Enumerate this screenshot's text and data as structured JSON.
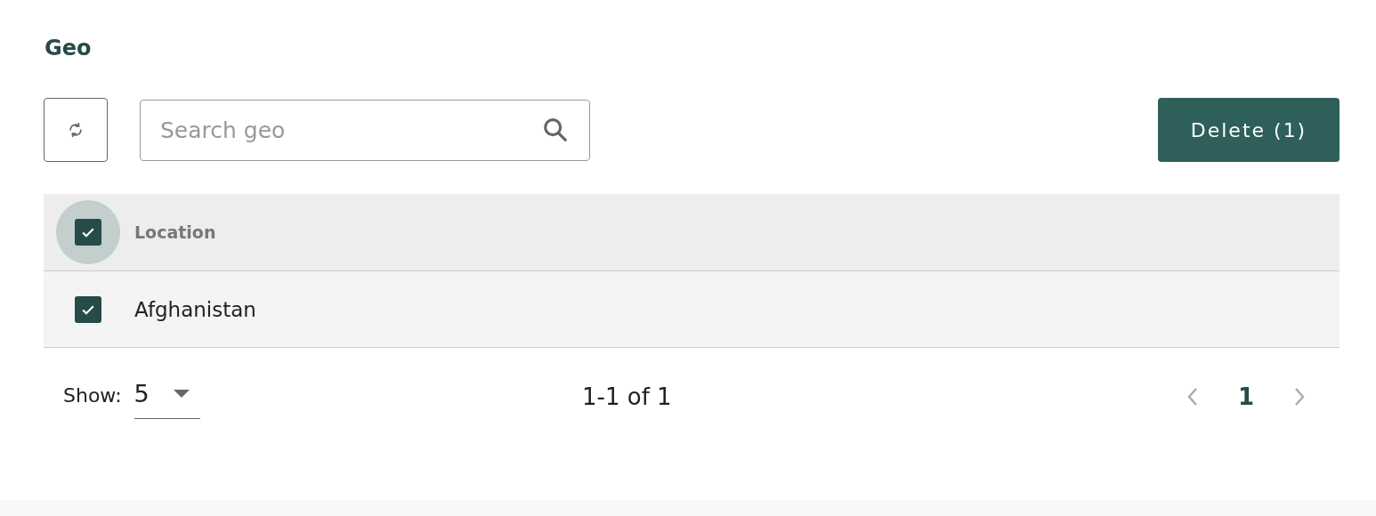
{
  "title": "Geo",
  "toolbar": {
    "search": {
      "placeholder": "Search geo"
    },
    "delete_button": "Delete (1)"
  },
  "table": {
    "select_all": {
      "checked": true
    },
    "columns": [
      "Location"
    ],
    "rows": [
      {
        "location": "Afghanistan",
        "checked": true
      }
    ]
  },
  "pagination": {
    "show_label": "Show:",
    "page_size": "5",
    "range": "1-1 of 1",
    "prev_disabled": true,
    "next_disabled": true,
    "pages": [
      {
        "label": "1",
        "selected": true
      }
    ]
  }
}
